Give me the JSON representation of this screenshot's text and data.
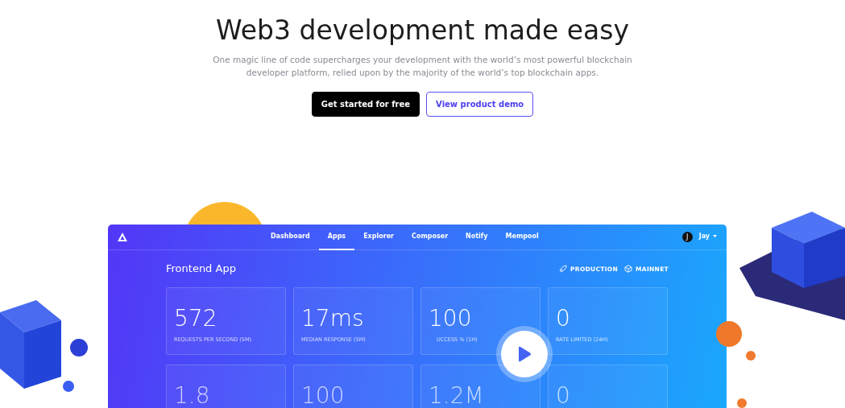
{
  "hero": {
    "title": "Web3 development made easy",
    "subtitle": "One magic line of code supercharges your development with the world’s most powerful blockchain developer platform, relied upon by the majority of the world’s top blockchain apps.",
    "buttons": [
      {
        "label": "Get started for free",
        "kind": "primary"
      },
      {
        "label": "View product demo",
        "kind": "outline"
      }
    ]
  },
  "dashboard": {
    "nav": [
      {
        "label": "Dashboard",
        "selected": false
      },
      {
        "label": "Apps",
        "selected": true
      },
      {
        "label": "Explorer",
        "selected": false
      },
      {
        "label": "Composer",
        "selected": false
      },
      {
        "label": "Notify",
        "selected": false
      },
      {
        "label": "Mempool",
        "selected": false
      }
    ],
    "user": {
      "initial": "J",
      "name": "Jay"
    },
    "app_title": "Frontend App",
    "tags": [
      {
        "label": "PRODUCTION",
        "kind": "rocket"
      },
      {
        "label": "MAINNET",
        "kind": "cube"
      }
    ],
    "stats": [
      {
        "value": "572",
        "label": "REQUESTS PER SECOND (5M)"
      },
      {
        "value": "17ms",
        "label": "MEDIAN RESPONSE (5M)"
      },
      {
        "value": "100",
        "label": "UCCESS % (1H)"
      },
      {
        "value": "0",
        "label": "RATE LIMITED (24H)"
      },
      {
        "value": "1.8"
      },
      {
        "value": "100"
      },
      {
        "value": "1.2M"
      },
      {
        "value": "0"
      }
    ]
  }
}
